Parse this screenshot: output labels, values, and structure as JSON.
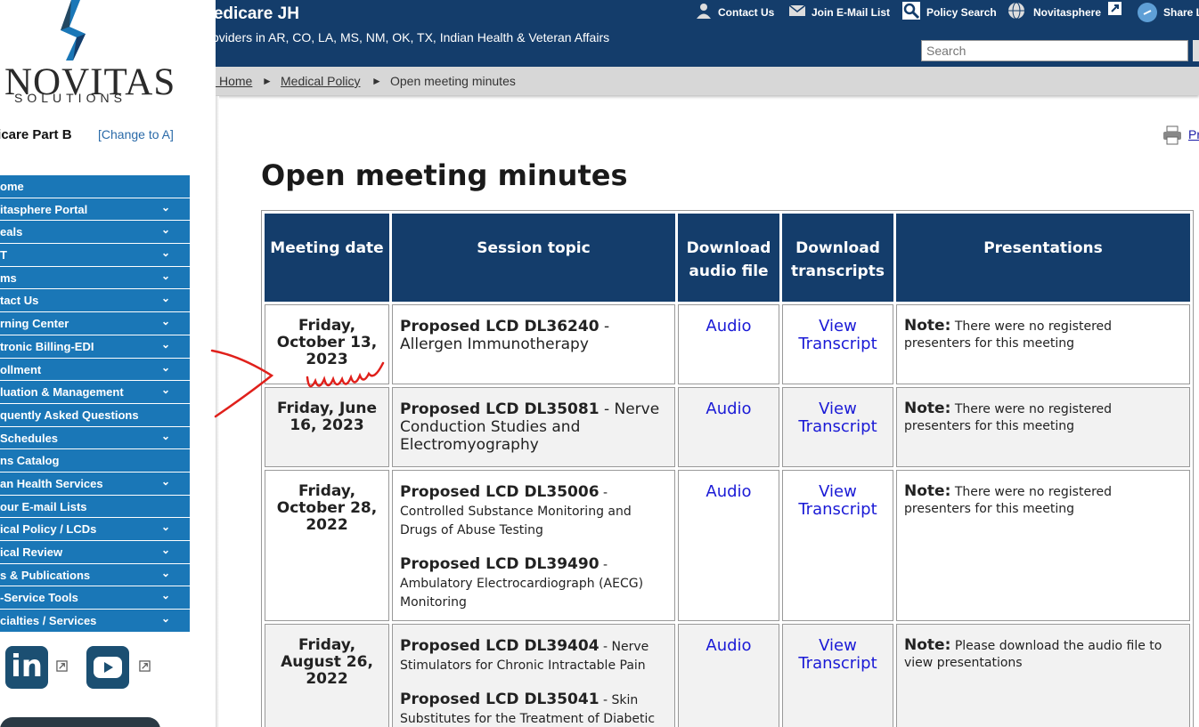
{
  "logo": {
    "word": "NOVITAS",
    "sub": "SOLUTIONS"
  },
  "contract": {
    "label": "dicare Part B",
    "change_link": "[Change to A]"
  },
  "sidebar": {
    "items": [
      {
        "label": "ome",
        "has_chevron": false
      },
      {
        "label": "itasphere Portal",
        "has_chevron": true
      },
      {
        "label": "eals",
        "has_chevron": true
      },
      {
        "label": "T",
        "has_chevron": true
      },
      {
        "label": "ms",
        "has_chevron": true
      },
      {
        "label": "tact Us",
        "has_chevron": true
      },
      {
        "label": "rning Center",
        "has_chevron": true
      },
      {
        "label": "tronic Billing-EDI",
        "has_chevron": true
      },
      {
        "label": "ollment",
        "has_chevron": true
      },
      {
        "label": "luation & Management",
        "has_chevron": true
      },
      {
        "label": "quently Asked Questions",
        "has_chevron": false
      },
      {
        "label": "Schedules",
        "has_chevron": true
      },
      {
        "label": "ns Catalog",
        "has_chevron": false
      },
      {
        "label": "an Health Services",
        "has_chevron": true
      },
      {
        "label": " our E-mail Lists",
        "has_chevron": false
      },
      {
        "label": "ical Policy / LCDs",
        "has_chevron": true
      },
      {
        "label": "ical Review",
        "has_chevron": true
      },
      {
        "label": "s & Publications",
        "has_chevron": true
      },
      {
        "label": "-Service Tools",
        "has_chevron": true
      },
      {
        "label": "cialties / Services",
        "has_chevron": true
      }
    ],
    "chevron": "⌄"
  },
  "social": {
    "linkedin": "in",
    "youtube": "youtube"
  },
  "header": {
    "title": "Medicare JH",
    "subtitle": "Providers in AR, CO, LA, MS, NM, OK, TX, Indian Health & Veteran Affairs",
    "links": {
      "contact": "Contact Us",
      "email": "Join E-Mail List",
      "policy": "Policy Search",
      "novitasphere": "Novitasphere",
      "share": "Share L"
    },
    "search_placeholder": "Search"
  },
  "breadcrumb": {
    "home": "JH Home",
    "policy": "Medical Policy",
    "current": "Open meeting minutes",
    "sep": "►"
  },
  "print_label": "Pr",
  "page_title": "Open meeting minutes",
  "table": {
    "headers": {
      "date": "Meeting date",
      "topic": "Session topic",
      "audio_1": "Download",
      "audio_2": "audio file",
      "trans_1": "Download",
      "trans_2": "transcripts",
      "pres": "Presentations"
    },
    "rows": [
      {
        "date_1": "Friday,",
        "date_2": "October 13,",
        "date_3": "2023",
        "t1_id": "Proposed LCD DL36240",
        "t1_desc": " - Allergen Immunotherapy",
        "audio": "Audio",
        "view": "View",
        "transcript": "Transcript",
        "note": "Note:",
        "note_text": " There were no registered presenters for this meeting"
      },
      {
        "date_1": "Friday, June",
        "date_2": "16, 2023",
        "t1_id": "Proposed LCD DL35081",
        "t1_desc": " - Nerve Conduction Studies and Electromyography",
        "audio": "Audio",
        "view": "View",
        "transcript": "Transcript",
        "note": "Note:",
        "note_text": " There were no registered presenters for this meeting"
      },
      {
        "date_1": "Friday,",
        "date_2": "October 28,",
        "date_3": "2022",
        "t1_id": "Proposed LCD DL35006",
        "t1_desc": " - Controlled Substance Monitoring and Drugs of Abuse Testing",
        "t2_id": "Proposed LCD DL39490",
        "t2_desc": " - Ambulatory Electrocardiograph (AECG) Monitoring",
        "audio": "Audio",
        "view": "View",
        "transcript": "Transcript",
        "note": "Note:",
        "note_text": " There were no registered presenters for this meeting"
      },
      {
        "date_1": "Friday,",
        "date_2": "August 26,",
        "date_3": "2022",
        "t1_id": "Proposed LCD DL39404",
        "t1_desc": " - Nerve Stimulators for Chronic Intractable Pain",
        "t2_id": "Proposed LCD DL35041",
        "t2_desc": " - Skin Substitutes for the Treatment of Diabetic",
        "audio": "Audio",
        "view": "View",
        "transcript": "Transcript",
        "note": "Note:",
        "note_text": " Please download the audio file to view presentations"
      }
    ]
  },
  "colors": {
    "header_bg": "#143d6b",
    "nav_bg": "#1a77b7",
    "link": "#1a1ad6",
    "annotation": "#e0201b"
  }
}
